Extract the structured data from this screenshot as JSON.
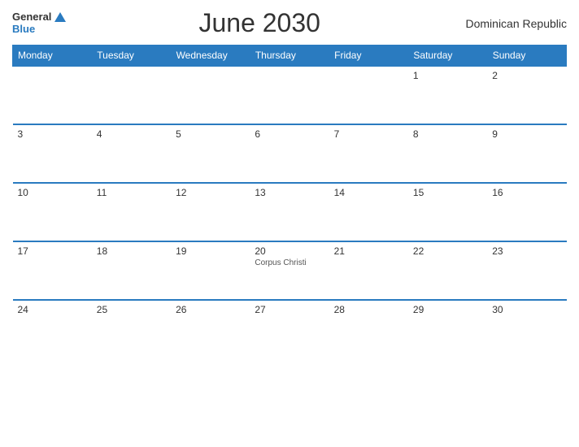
{
  "header": {
    "logo_general": "General",
    "logo_blue": "Blue",
    "title": "June 2030",
    "country": "Dominican Republic"
  },
  "calendar": {
    "weekdays": [
      "Monday",
      "Tuesday",
      "Wednesday",
      "Thursday",
      "Friday",
      "Saturday",
      "Sunday"
    ],
    "rows": [
      [
        {
          "day": "",
          "empty": true
        },
        {
          "day": "",
          "empty": true
        },
        {
          "day": "",
          "empty": true
        },
        {
          "day": "",
          "empty": true
        },
        {
          "day": "",
          "empty": true
        },
        {
          "day": "1",
          "empty": false
        },
        {
          "day": "2",
          "empty": false
        }
      ],
      [
        {
          "day": "3",
          "empty": false
        },
        {
          "day": "4",
          "empty": false
        },
        {
          "day": "5",
          "empty": false
        },
        {
          "day": "6",
          "empty": false
        },
        {
          "day": "7",
          "empty": false
        },
        {
          "day": "8",
          "empty": false
        },
        {
          "day": "9",
          "empty": false
        }
      ],
      [
        {
          "day": "10",
          "empty": false
        },
        {
          "day": "11",
          "empty": false
        },
        {
          "day": "12",
          "empty": false
        },
        {
          "day": "13",
          "empty": false
        },
        {
          "day": "14",
          "empty": false
        },
        {
          "day": "15",
          "empty": false
        },
        {
          "day": "16",
          "empty": false
        }
      ],
      [
        {
          "day": "17",
          "empty": false
        },
        {
          "day": "18",
          "empty": false
        },
        {
          "day": "19",
          "empty": false
        },
        {
          "day": "20",
          "empty": false,
          "event": "Corpus Christi"
        },
        {
          "day": "21",
          "empty": false
        },
        {
          "day": "22",
          "empty": false
        },
        {
          "day": "23",
          "empty": false
        }
      ],
      [
        {
          "day": "24",
          "empty": false
        },
        {
          "day": "25",
          "empty": false
        },
        {
          "day": "26",
          "empty": false
        },
        {
          "day": "27",
          "empty": false
        },
        {
          "day": "28",
          "empty": false
        },
        {
          "day": "29",
          "empty": false
        },
        {
          "day": "30",
          "empty": false
        }
      ]
    ]
  }
}
